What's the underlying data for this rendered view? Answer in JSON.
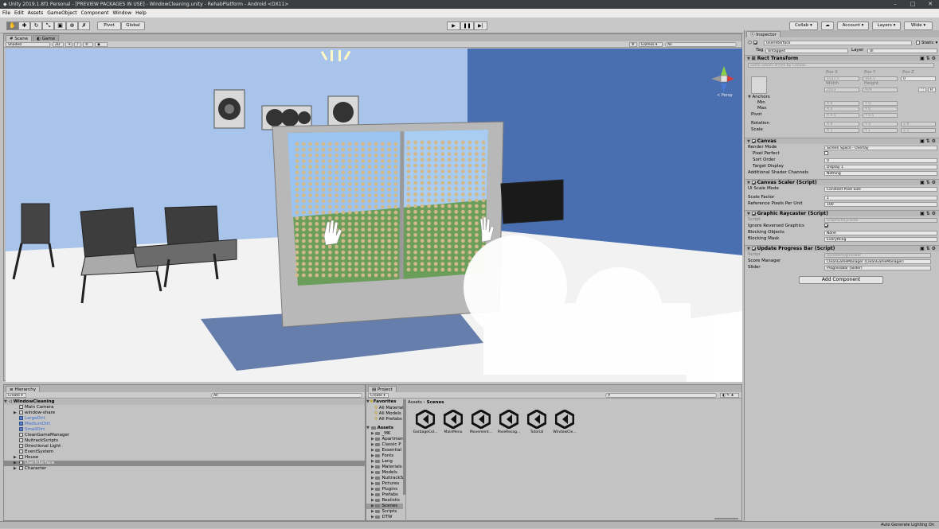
{
  "window": {
    "title": "Unity 2019.1.8f1 Personal - [PREVIEW PACKAGES IN USE] - WindowCleaning.unity - RehabPlatform - Android <DX11>",
    "minimize": "–",
    "maximize": "□",
    "close": "✕"
  },
  "menu": [
    "File",
    "Edit",
    "Assets",
    "GameObject",
    "Component",
    "Window",
    "Help"
  ],
  "toolbar": {
    "pivot": "Pivot",
    "global": "Global",
    "collab": "Collab ▾",
    "account": "Account ▾",
    "layers": "Layers ▾",
    "layout": "Wide ▾"
  },
  "scene": {
    "tabs": [
      "Scene",
      "Game"
    ],
    "shading": "Shaded",
    "mode2d": "2D",
    "gizmos": "Gizmos ▾",
    "search": "All",
    "persp": "< Persp"
  },
  "inspector": {
    "tab": "Inspector",
    "object_name": "UserInterface",
    "static_label": "Static ▾",
    "tag_label": "Tag",
    "tag_value": "Untagged",
    "layer_label": "Layer",
    "layer_value": "UI",
    "rect": {
      "title": "Rect Transform",
      "note": "Some values driven by Canvas.",
      "posx_label": "Pos X",
      "posy_label": "Pos Y",
      "posz_label": "Pos Z",
      "posx": "1011.5",
      "posy": "464.5",
      "posz": "0",
      "width_label": "Width",
      "height_label": "Height",
      "width": "2023",
      "height": "929",
      "blueprint": "R",
      "anchors": "Anchors",
      "min": "Min",
      "max": "Max",
      "pivot": "Pivot",
      "min_x": "0",
      "min_y": "0",
      "max_x": "0",
      "max_y": "0",
      "pivot_x": "0.5",
      "pivot_y": "0.5",
      "rotation": "Rotation",
      "rot_x": "0",
      "rot_y": "0",
      "rot_z": "0",
      "scale": "Scale",
      "scale_x": "1",
      "scale_y": "1",
      "scale_z": "1"
    },
    "canvas": {
      "title": "Canvas",
      "render_mode_label": "Render Mode",
      "render_mode": "Screen Space - Overlay",
      "pixel_perfect": "Pixel Perfect",
      "sort_order_label": "Sort Order",
      "sort_order": "0",
      "target_display_label": "Target Display",
      "target_display": "Display 1",
      "shader_channels_label": "Additional Shader Channels",
      "shader_channels": "Nothing"
    },
    "scaler": {
      "title": "Canvas Scaler (Script)",
      "ui_scale_label": "UI Scale Mode",
      "ui_scale": "Constant Pixel Size",
      "scale_factor_label": "Scale Factor",
      "scale_factor": "1",
      "ref_ppu_label": "Reference Pixels Per Unit",
      "ref_ppu": "100"
    },
    "raycaster": {
      "title": "Graphic Raycaster (Script)",
      "script_label": "Script",
      "script": "GraphicRaycaster",
      "ignore_label": "Ignore Reversed Graphics",
      "blocking_label": "Blocking Objects",
      "blocking": "None",
      "mask_label": "Blocking Mask",
      "mask": "Everything"
    },
    "progress": {
      "title": "Update Progress Bar (Script)",
      "script_label": "Script",
      "script": "UpdateProgressBar",
      "score_label": "Score Manager",
      "score": "CleanGameManager (CleanGameManager)",
      "slider_label": "Slider",
      "slider": "ProgressBar (Slider)"
    },
    "add_component": "Add Component"
  },
  "hierarchy": {
    "tab": "Hierarchy",
    "create": "Create ▾",
    "search": "All",
    "scene": "WindowCleaning",
    "items": [
      {
        "label": "Main Camera",
        "indent": 2,
        "arrow": "",
        "blue": false
      },
      {
        "label": "window-share",
        "indent": 2,
        "arrow": "▶",
        "blue": false
      },
      {
        "label": "LargeDirt",
        "indent": 2,
        "arrow": "",
        "blue": true
      },
      {
        "label": "MediumDirt",
        "indent": 2,
        "arrow": "",
        "blue": true
      },
      {
        "label": "SmallDirt",
        "indent": 2,
        "arrow": "",
        "blue": true
      },
      {
        "label": "CleanGameManager",
        "indent": 2,
        "arrow": "",
        "blue": false
      },
      {
        "label": "NuitrackScripts",
        "indent": 2,
        "arrow": "",
        "blue": false
      },
      {
        "label": "Directional Light",
        "indent": 2,
        "arrow": "",
        "blue": false
      },
      {
        "label": "EventSystem",
        "indent": 2,
        "arrow": "",
        "blue": false
      },
      {
        "label": "House",
        "indent": 2,
        "arrow": "▶",
        "blue": false
      },
      {
        "label": "UserInterface",
        "indent": 2,
        "arrow": "▶",
        "blue": false,
        "selected": true
      },
      {
        "label": "Character",
        "indent": 2,
        "arrow": "▶",
        "blue": false
      }
    ]
  },
  "project": {
    "tab": "Project",
    "create": "Create ▾",
    "search": "",
    "favorites": {
      "label": "Favorites",
      "items": [
        "All Materials",
        "All Models",
        "All Prefabs"
      ]
    },
    "assets_label": "Assets",
    "folders": [
      "_MK",
      "Apartment",
      "Classic P",
      "Essential",
      "Fonts",
      "Lang",
      "Materials",
      "Models",
      "NuitrackS",
      "Pictures",
      "Plugins",
      "Prefabs",
      "Realistic",
      "Scenes",
      "Scripts",
      "DTW"
    ],
    "breadcrumb": {
      "root": "Assets",
      "sep": "›",
      "current": "Scenes"
    },
    "scenes": [
      "GarbageCol...",
      "MainMenu",
      "Movement...",
      "PoseRecog...",
      "Tutorial",
      "WindowCle..."
    ]
  },
  "status": "Auto Generate Lighting On",
  "colors": {
    "selection": "#8a8a8a",
    "blue_prefab": "#3d6bd3",
    "sky": "#9fc2ea",
    "floor": "#f2f2f2",
    "wall": "#4a6fb1"
  }
}
